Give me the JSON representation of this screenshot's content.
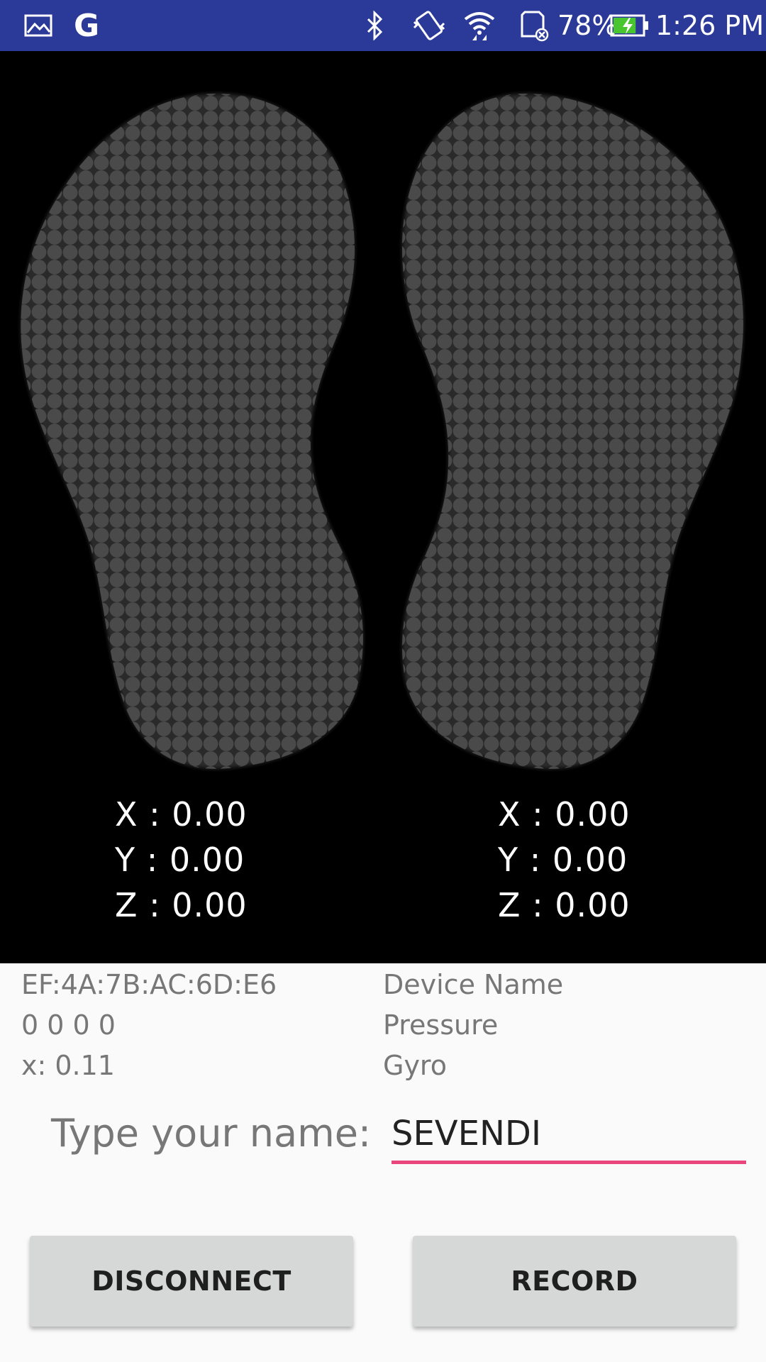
{
  "status_bar": {
    "color": "#2b3a98",
    "icons_left": [
      "gallery-icon",
      "google-icon"
    ],
    "google_letter": "G",
    "icons_right": [
      "bluetooth-icon",
      "vibrate-icon",
      "wifi-icon",
      "sd-card-icon",
      "battery-charging-icon"
    ],
    "battery_percent": "78%",
    "battery_level": 0.78,
    "time": "1:26 PM"
  },
  "feet": {
    "left": {
      "x": "X : 0.00",
      "y": "Y : 0.00",
      "z": "Z : 0.00"
    },
    "right": {
      "x": "X : 0.00",
      "y": "Y : 0.00",
      "z": "Z : 0.00"
    }
  },
  "info": {
    "left_col": [
      "EF:4A:7B:AC:6D:E6",
      "0 0 0 0",
      "x: 0.11"
    ],
    "right_col": [
      "Device Name",
      "Pressure",
      "Gyro"
    ]
  },
  "name_form": {
    "label": "Type your name:",
    "value": "SEVENDI",
    "underline_color": "#e8467c"
  },
  "buttons": {
    "disconnect": "DISCONNECT",
    "record": "RECORD"
  }
}
